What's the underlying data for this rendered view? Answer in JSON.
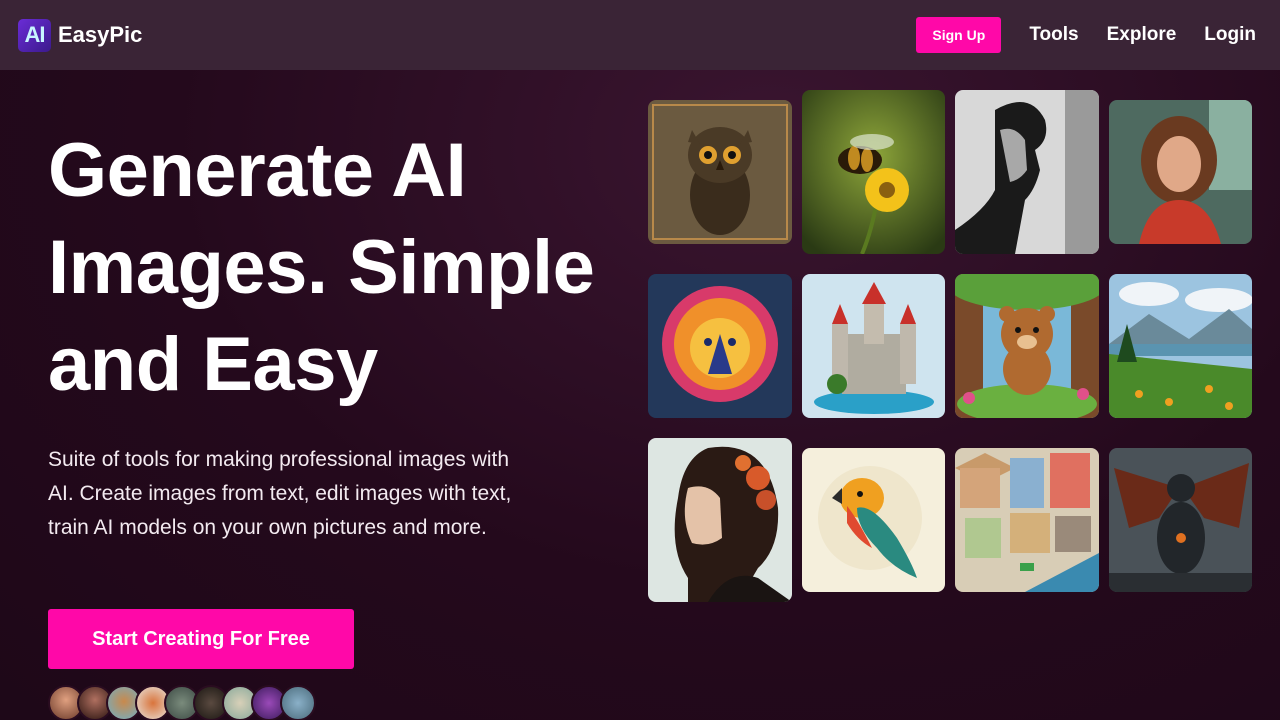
{
  "nav": {
    "logo_text": "AI",
    "brand": "EasyPic",
    "signup_label": "Sign Up",
    "links": [
      "Tools",
      "Explore",
      "Login"
    ]
  },
  "hero": {
    "title_lines": [
      "Generate AI",
      "Images. Simple",
      "and Easy"
    ],
    "description": "Suite of tools for making professional images with AI. Create images from text, edit images with text, train AI models on your own pictures and more.",
    "cta_label": "Start Creating For Free"
  },
  "colors": {
    "accent": "#ff08a8",
    "navbar": "#3a2436",
    "background": "#24091c"
  },
  "gallery": [
    {
      "name": "owl-image"
    },
    {
      "name": "bee-image"
    },
    {
      "name": "bw-profile-image"
    },
    {
      "name": "woman-portrait-image"
    },
    {
      "name": "lion-image"
    },
    {
      "name": "castle-image"
    },
    {
      "name": "bear-image"
    },
    {
      "name": "landscape-image"
    },
    {
      "name": "floral-woman-image"
    },
    {
      "name": "parrot-image"
    },
    {
      "name": "city-image"
    },
    {
      "name": "dragon-image"
    }
  ],
  "avatar_count": 9
}
